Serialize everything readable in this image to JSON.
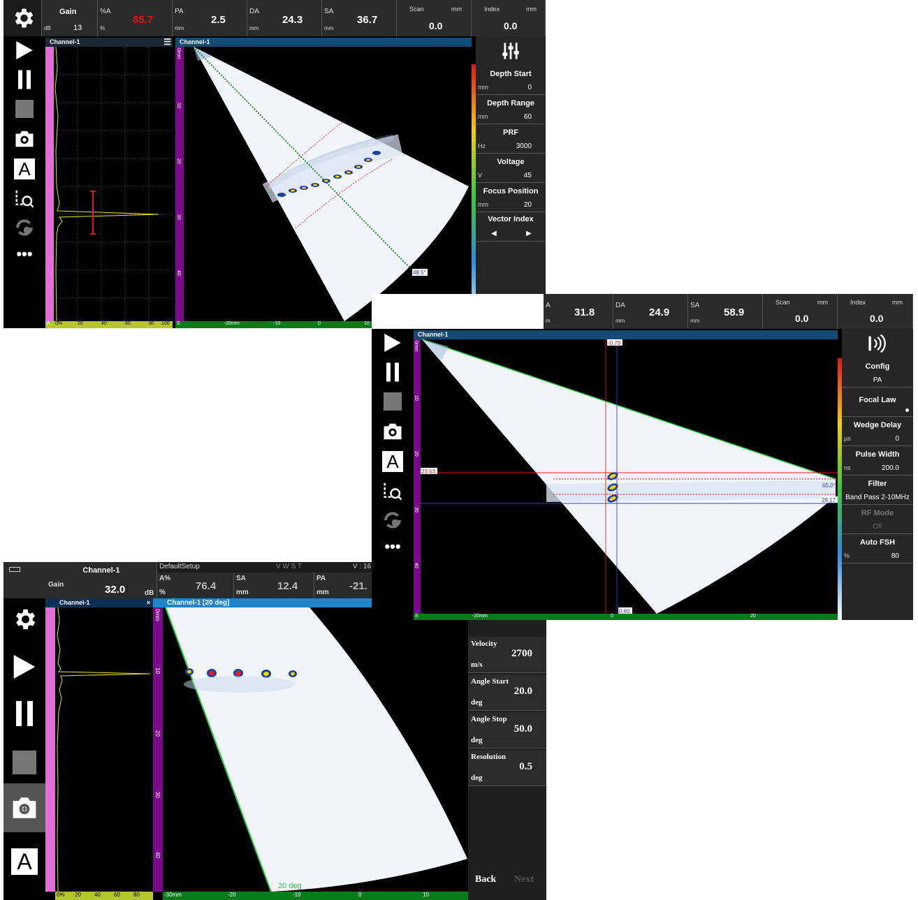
{
  "s1": {
    "header": {
      "gain_label": "Gain",
      "gain_unit": "dB",
      "gain_value": "13",
      "pa_label": "%A",
      "pa_unit": "%",
      "pa_value": "85.7",
      "pa2_label": "PA",
      "pa2_unit": "mm",
      "pa2_value": "2.5",
      "da_label": "DA",
      "da_unit": "mm",
      "da_value": "24.3",
      "sa_label": "SA",
      "sa_unit": "mm",
      "sa_value": "36.7",
      "scan_label": "Scan",
      "scan_unit": "mm",
      "scan_value": "0.0",
      "index_label": "Index",
      "index_unit": "mm",
      "index_value": "0.0"
    },
    "channel_a": "Channel-1",
    "channel_s": "Channel-1",
    "angle_label": "48.5°",
    "ruler_s": "S",
    "ruler_a": "A",
    "ruler_x": [
      "-20mm",
      "-10",
      "0",
      "10",
      "20",
      "30"
    ],
    "ruler_pct": [
      "0%",
      "20",
      "40",
      "60",
      "80",
      "100"
    ],
    "ruler_depth": [
      "0mm",
      "10",
      "20",
      "30",
      "40",
      "50",
      "60"
    ],
    "panel": [
      {
        "title": "Depth Start",
        "unit": "mm",
        "value": "0"
      },
      {
        "title": "Depth Range",
        "unit": "mm",
        "value": "60"
      },
      {
        "title": "PRF",
        "unit": "Hz",
        "value": "3000"
      },
      {
        "title": "Voltage",
        "unit": "V",
        "value": "45"
      },
      {
        "title": "Focus Position",
        "unit": "mm",
        "value": "20"
      },
      {
        "title": "Vector Index",
        "unit": "",
        "value": ""
      }
    ]
  },
  "s2": {
    "header": {
      "pa_label": "A",
      "pa_unit": "m",
      "pa_value": "31.8",
      "da_label": "DA",
      "da_unit": "mm",
      "da_value": "24.9",
      "sa_label": "SA",
      "sa_unit": "mm",
      "sa_value": "58.9",
      "scan_label": "Scan",
      "scan_unit": "mm",
      "scan_value": "0.0",
      "index_label": "Index",
      "index_unit": "mm",
      "index_value": "0.0"
    },
    "channel": "Channel-1",
    "cursor_top": "-0.79",
    "cursor_bottom": "0.60",
    "cursor_left": "23.63",
    "cursor_right1": "65.0°",
    "cursor_right2": "29.17",
    "ruler_s": "S",
    "ruler_x": [
      "-20mm",
      "0",
      "20"
    ],
    "ruler_depth": [
      "0mm",
      "10",
      "20",
      "30",
      "40"
    ],
    "panel": [
      {
        "title": "Config",
        "unit": "",
        "value": "PA"
      },
      {
        "title": "Focal Law",
        "unit": "",
        "value": ""
      },
      {
        "title": "Wedge Delay",
        "unit": "µs",
        "value": "0"
      },
      {
        "title": "Pulse Width",
        "unit": "ns",
        "value": "200.0"
      },
      {
        "title": "Filter",
        "unit": "",
        "value": "Band Pass 2-10MHz"
      },
      {
        "title": "RF Mode",
        "unit": "",
        "value": "Off"
      },
      {
        "title": "Auto FSH",
        "unit": "%",
        "value": "80"
      }
    ]
  },
  "s3": {
    "header": {
      "channel": "Channel-1",
      "setup": "DefaultSetup",
      "vwst": "V W S T",
      "v_label": "V : 16",
      "gain_label": "Gain",
      "gain_unit": "dB",
      "gain_value": "32.0",
      "a_label": "A%",
      "a_unit": "%",
      "a_value": "76.4",
      "sa_label": "SA",
      "sa_unit": "mm",
      "sa_value": "12.4",
      "pa_label": "PA",
      "pa_unit": "mm",
      "pa_value": "-21."
    },
    "channel_a": "Channel-1",
    "channel_s": "Channel-1 [20 deg]",
    "close_glyph": "×",
    "angle_label": "20 deg",
    "ruler_x": [
      "-30mm",
      "-20",
      "-10",
      "0",
      "10"
    ],
    "ruler_pct": [
      "0%",
      "20",
      "40",
      "60",
      "80"
    ],
    "ruler_depth": [
      "0mm",
      "10",
      "20",
      "30",
      "40"
    ],
    "panel": [
      {
        "title": "Velocity",
        "unit": "m/s",
        "value": "2700"
      },
      {
        "title": "Angle Start",
        "unit": "deg",
        "value": "20.0"
      },
      {
        "title": "Angle Stop",
        "unit": "deg",
        "value": "50.0"
      },
      {
        "title": "Resolution",
        "unit": "deg",
        "value": "0.5"
      }
    ],
    "back": "Back",
    "next": "Next"
  }
}
